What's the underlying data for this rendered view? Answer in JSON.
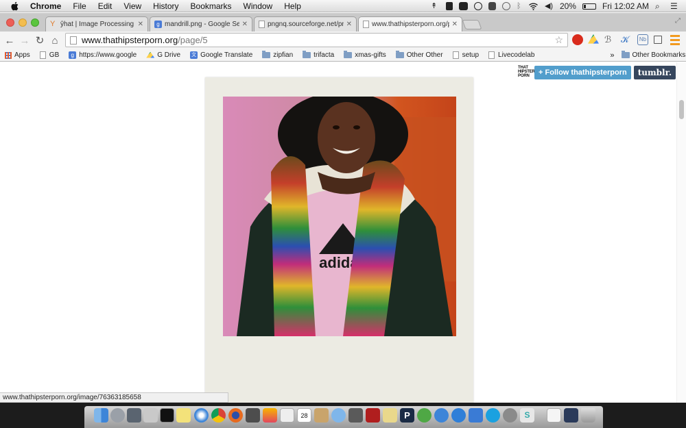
{
  "menubar": {
    "app": "Chrome",
    "menus": [
      "File",
      "Edit",
      "View",
      "History",
      "Bookmarks",
      "Window",
      "Help"
    ],
    "battery": "20%",
    "clock": "Fri 12:02 AM"
  },
  "tabs": [
    {
      "title": "ŷhat | Image Processing w",
      "favicon": "yhat-icon"
    },
    {
      "title": "mandrill.png - Google Sea",
      "favicon": "google-icon"
    },
    {
      "title": "pngnq.sourceforge.net/pn",
      "favicon": "page-icon"
    },
    {
      "title": "www.thathipsterporn.org/p",
      "favicon": "page-icon",
      "active": true
    }
  ],
  "omnibox": {
    "host": "www.thathipsterporn.org",
    "path": "/page/5"
  },
  "bookmarks": [
    {
      "label": "Apps",
      "icon": "apps-icon"
    },
    {
      "label": "GB",
      "icon": "doc-icon"
    },
    {
      "label": "https://www.google",
      "icon": "google-icon"
    },
    {
      "label": "G Drive",
      "icon": "drive-icon"
    },
    {
      "label": "Google Translate",
      "icon": "translate-icon"
    },
    {
      "label": "zipfian",
      "icon": "folder-icon"
    },
    {
      "label": "trifacta",
      "icon": "folder-icon"
    },
    {
      "label": "xmas-gifts",
      "icon": "folder-icon"
    },
    {
      "label": "Other Other",
      "icon": "folder-icon"
    },
    {
      "label": "setup",
      "icon": "doc-icon"
    },
    {
      "label": "Livecodelab",
      "icon": "doc-icon"
    }
  ],
  "bookmarks_overflow": "»",
  "other_bookmarks": "Other Bookmarks",
  "tumblr": {
    "logo_text": "THAT HIPSTER PORN",
    "follow": "+ Follow thathipsterporn",
    "brand": "tumblr."
  },
  "status_url": "www.thathipsterporn.org/image/76363185658",
  "photo": {
    "shirt_text": "adidas"
  },
  "colors": {
    "follow": "#529ecc",
    "tumblr": "#36465d"
  }
}
